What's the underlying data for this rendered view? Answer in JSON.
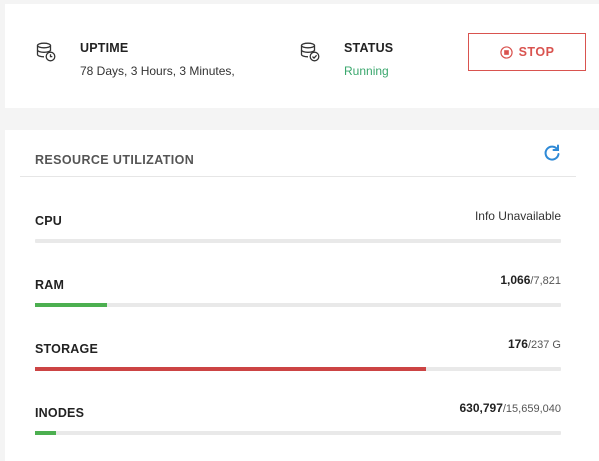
{
  "status_card": {
    "uptime_label": "UPTIME",
    "uptime_value": "78 Days, 3 Hours, 3 Minutes,",
    "uptime_icon": "database-clock-icon",
    "status_label": "STATUS",
    "status_value": "Running",
    "status_icon": "database-check-icon",
    "status_color": "#3aa76d",
    "stop_button": {
      "label": "STOP",
      "icon": "stop-circle-icon",
      "color": "#d9534f"
    }
  },
  "resources": {
    "title": "RESOURCE UTILIZATION",
    "refresh_icon": "refresh-icon",
    "refresh_color": "#2f8ad6",
    "items": [
      {
        "label": "CPU",
        "text": "Info Unavailable",
        "used": "",
        "total": "",
        "fraction": 0,
        "color": "#4caf50"
      },
      {
        "label": "RAM",
        "text": "",
        "used": "1,066",
        "total": "/7,821",
        "fraction": 0.136,
        "color": "#4caf50"
      },
      {
        "label": "STORAGE",
        "text": "",
        "used": "176",
        "total": "/237 G",
        "fraction": 0.743,
        "color": "#cc4444"
      },
      {
        "label": "INODES",
        "text": "",
        "used": "630,797",
        "total": "/15,659,040",
        "fraction": 0.04,
        "color": "#4caf50"
      }
    ]
  }
}
